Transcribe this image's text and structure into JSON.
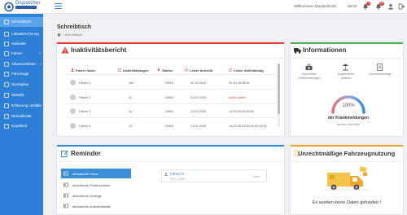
{
  "header": {
    "logo_text": "Dispatcher",
    "welcome": "Willkommen DispatchCtrls",
    "time": "08:53",
    "notifications_count": "1",
    "alerts_count": "23"
  },
  "sidebar": {
    "items": [
      {
        "label": "Schreibtisch",
        "icon": "desk-icon",
        "active": true
      },
      {
        "label": "Lohnabrechnung",
        "icon": "payroll-icon"
      },
      {
        "label": "Kalender",
        "icon": "calendar-icon"
      },
      {
        "label": "Fahrer",
        "icon": "driver-icon",
        "chevron": "›"
      },
      {
        "label": "Abwesenheiten",
        "icon": "absence-icon",
        "chevron": "›"
      },
      {
        "label": "Fahrzeuge",
        "icon": "truck-icon"
      },
      {
        "label": "Dienstplan",
        "icon": "schedule-icon"
      },
      {
        "label": "Statistik",
        "icon": "stats-icon"
      },
      {
        "label": "Erfassung Umfälle",
        "icon": "accident-icon"
      },
      {
        "label": "Reinaktivität",
        "icon": "activity-icon"
      },
      {
        "label": "Krankheit",
        "icon": "sickness-icon"
      }
    ]
  },
  "page": {
    "title": "Schreibtisch",
    "breadcrumb": "Schreibtisch"
  },
  "inactivity": {
    "title": "Inaktivitätsbericht",
    "columns": [
      "Fahrer Name",
      "Inaktivitätstagen",
      "Station",
      "Letzte Aktivität",
      "Letzer Aktivitätstag"
    ],
    "rows": [
      {
        "name": "Fahrer 1",
        "days": "152",
        "station": "DHE4",
        "last": "02.10.2024",
        "last_day": "10.10-18:30:00",
        "red": false
      },
      {
        "name": "Fahrer 2",
        "days": "31",
        "station": "DHE4",
        "last": "01.02.2025",
        "last_day": "Keine Daten",
        "red": true
      },
      {
        "name": "Fahrer 3",
        "days": "14",
        "station": "DHE4",
        "last": "13.02.2025",
        "last_day": "14.03.28-03:30:00",
        "red": false
      },
      {
        "name": "Fahrer 4",
        "days": "14",
        "station": "DHE4",
        "last": "13.02.2025",
        "last_day": "14.03.28-03:30:00,04:16:00",
        "red": false
      }
    ]
  },
  "info": {
    "title": "Informationen",
    "items": [
      {
        "label": "Gemeldete Krankmeldungen",
        "icon": "sick-report-icon"
      },
      {
        "label": "Angefordeter Urlaubs",
        "icon": "vacation-icon"
      },
      {
        "label": "Dokumentenlage",
        "icon": "documents-icon"
      }
    ],
    "gauge_percent": "100%",
    "gauge_value": 1.0,
    "gauge_label": "der Krankmeldungen",
    "gauge_sublabel": "wurden bearbeitet"
  },
  "reminder": {
    "title": "Reminder",
    "items": [
      {
        "label": "ablaufende Pässe",
        "active": true
      },
      {
        "label": "ablaufende Führerscheine"
      },
      {
        "label": "ablaufende Verträge"
      },
      {
        "label": "ablaufende Aufenthaltstitel"
      }
    ],
    "entry_name": "Fahrer 5",
    "entry_sub": "PEC1.2025",
    "entry_action": "Wert"
  },
  "vehicle": {
    "title": "Unrechtmäßige Fahrzeugnutzung",
    "empty": "Es wurden keine Daten gefunden !"
  },
  "colors": {
    "sidebar": "#2e7fd6",
    "active": "#5aa3ea",
    "red": "#e53935",
    "green": "#4caf50",
    "orange": "#f4a62a"
  }
}
